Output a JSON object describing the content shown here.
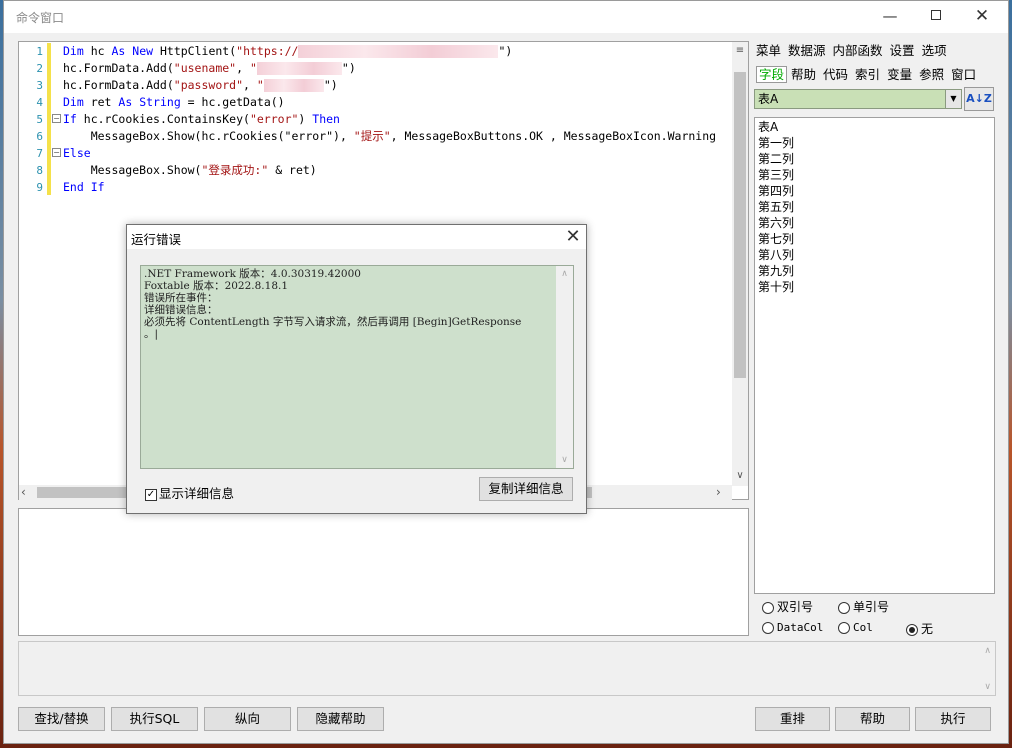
{
  "window": {
    "title": "命令窗口"
  },
  "editor": {
    "line_numbers": [
      "1",
      "2",
      "3",
      "4",
      "5",
      "6",
      "7",
      "8",
      "9"
    ],
    "lines": [
      {
        "parts": [
          {
            "t": "Dim",
            "c": "kw"
          },
          {
            "t": " hc "
          },
          {
            "t": "As",
            "c": "kw"
          },
          {
            "t": " "
          },
          {
            "t": "New",
            "c": "kw"
          },
          {
            "t": " HttpClient("
          },
          {
            "t": "\"https://",
            "c": "str"
          },
          {
            "t": "",
            "c": "blur"
          },
          {
            "t": "\")"
          }
        ]
      },
      {
        "parts": [
          {
            "t": "hc.FormData.Add("
          },
          {
            "t": "\"usename\"",
            "c": "str"
          },
          {
            "t": ", "
          },
          {
            "t": "\"",
            "c": "str"
          },
          {
            "t": "",
            "c": "blur b2"
          },
          {
            "t": "\")"
          }
        ]
      },
      {
        "parts": [
          {
            "t": "hc.FormData.Add("
          },
          {
            "t": "\"password\"",
            "c": "str"
          },
          {
            "t": ", "
          },
          {
            "t": "\"",
            "c": "str"
          },
          {
            "t": "",
            "c": "blur b3"
          },
          {
            "t": "\")"
          }
        ]
      },
      {
        "parts": [
          {
            "t": "Dim",
            "c": "kw"
          },
          {
            "t": " ret "
          },
          {
            "t": "As",
            "c": "kw"
          },
          {
            "t": " "
          },
          {
            "t": "String",
            "c": "kw"
          },
          {
            "t": " = hc.getData()"
          }
        ]
      },
      {
        "parts": [
          {
            "t": "If",
            "c": "kw"
          },
          {
            "t": " hc.rCookies.ContainsKey("
          },
          {
            "t": "\"error\"",
            "c": "str"
          },
          {
            "t": ") "
          },
          {
            "t": "Then",
            "c": "kw"
          }
        ]
      },
      {
        "parts": [
          {
            "t": "    MessageBox.Show(hc.rCookies(\"error\"), "
          },
          {
            "t": "\"提示\"",
            "c": "str"
          },
          {
            "t": ", MessageBoxButtons.OK , MessageBoxIcon.Warning"
          }
        ]
      },
      {
        "parts": [
          {
            "t": "Else",
            "c": "kw"
          }
        ]
      },
      {
        "parts": [
          {
            "t": "    MessageBox.Show("
          },
          {
            "t": "\"登录成功:\"",
            "c": "str"
          },
          {
            "t": " & ret)"
          }
        ]
      },
      {
        "parts": [
          {
            "t": "End If",
            "c": "kw"
          }
        ]
      }
    ]
  },
  "right_panel": {
    "menu_row1": [
      "菜单",
      "数据源",
      "内部函数",
      "设置",
      "选项"
    ],
    "menu_row2": [
      "字段",
      "帮助",
      "代码",
      "索引",
      "变量",
      "参照",
      "窗口"
    ],
    "table_combo": "表A",
    "fields": [
      "表A",
      "第一列",
      "第二列",
      "第三列",
      "第四列",
      "第五列",
      "第六列",
      "第七列",
      "第八列",
      "第九列",
      "第十列"
    ],
    "radios": {
      "double_quote": "双引号",
      "single_quote": "单引号",
      "datacol": "DataCol",
      "col": "Col",
      "none": "无"
    }
  },
  "buttons": {
    "find_replace": "查找/替换",
    "exec_sql": "执行SQL",
    "vertical": "纵向",
    "hide_help": "隐藏帮助",
    "rearrange": "重排",
    "help": "帮助",
    "execute": "执行"
  },
  "dialog": {
    "title": "运行错误",
    "detail_lines": [
      ".NET Framework 版本：4.0.30319.42000",
      "Foxtable 版本：2022.8.18.1",
      "错误所在事件：",
      "详细错误信息：",
      "必须先将 ContentLength 字节写入请求流，然后再调用 [Begin]GetResponse",
      "。|"
    ],
    "show_detail_label": "显示详细信息",
    "copy_button": "复制详细信息"
  }
}
